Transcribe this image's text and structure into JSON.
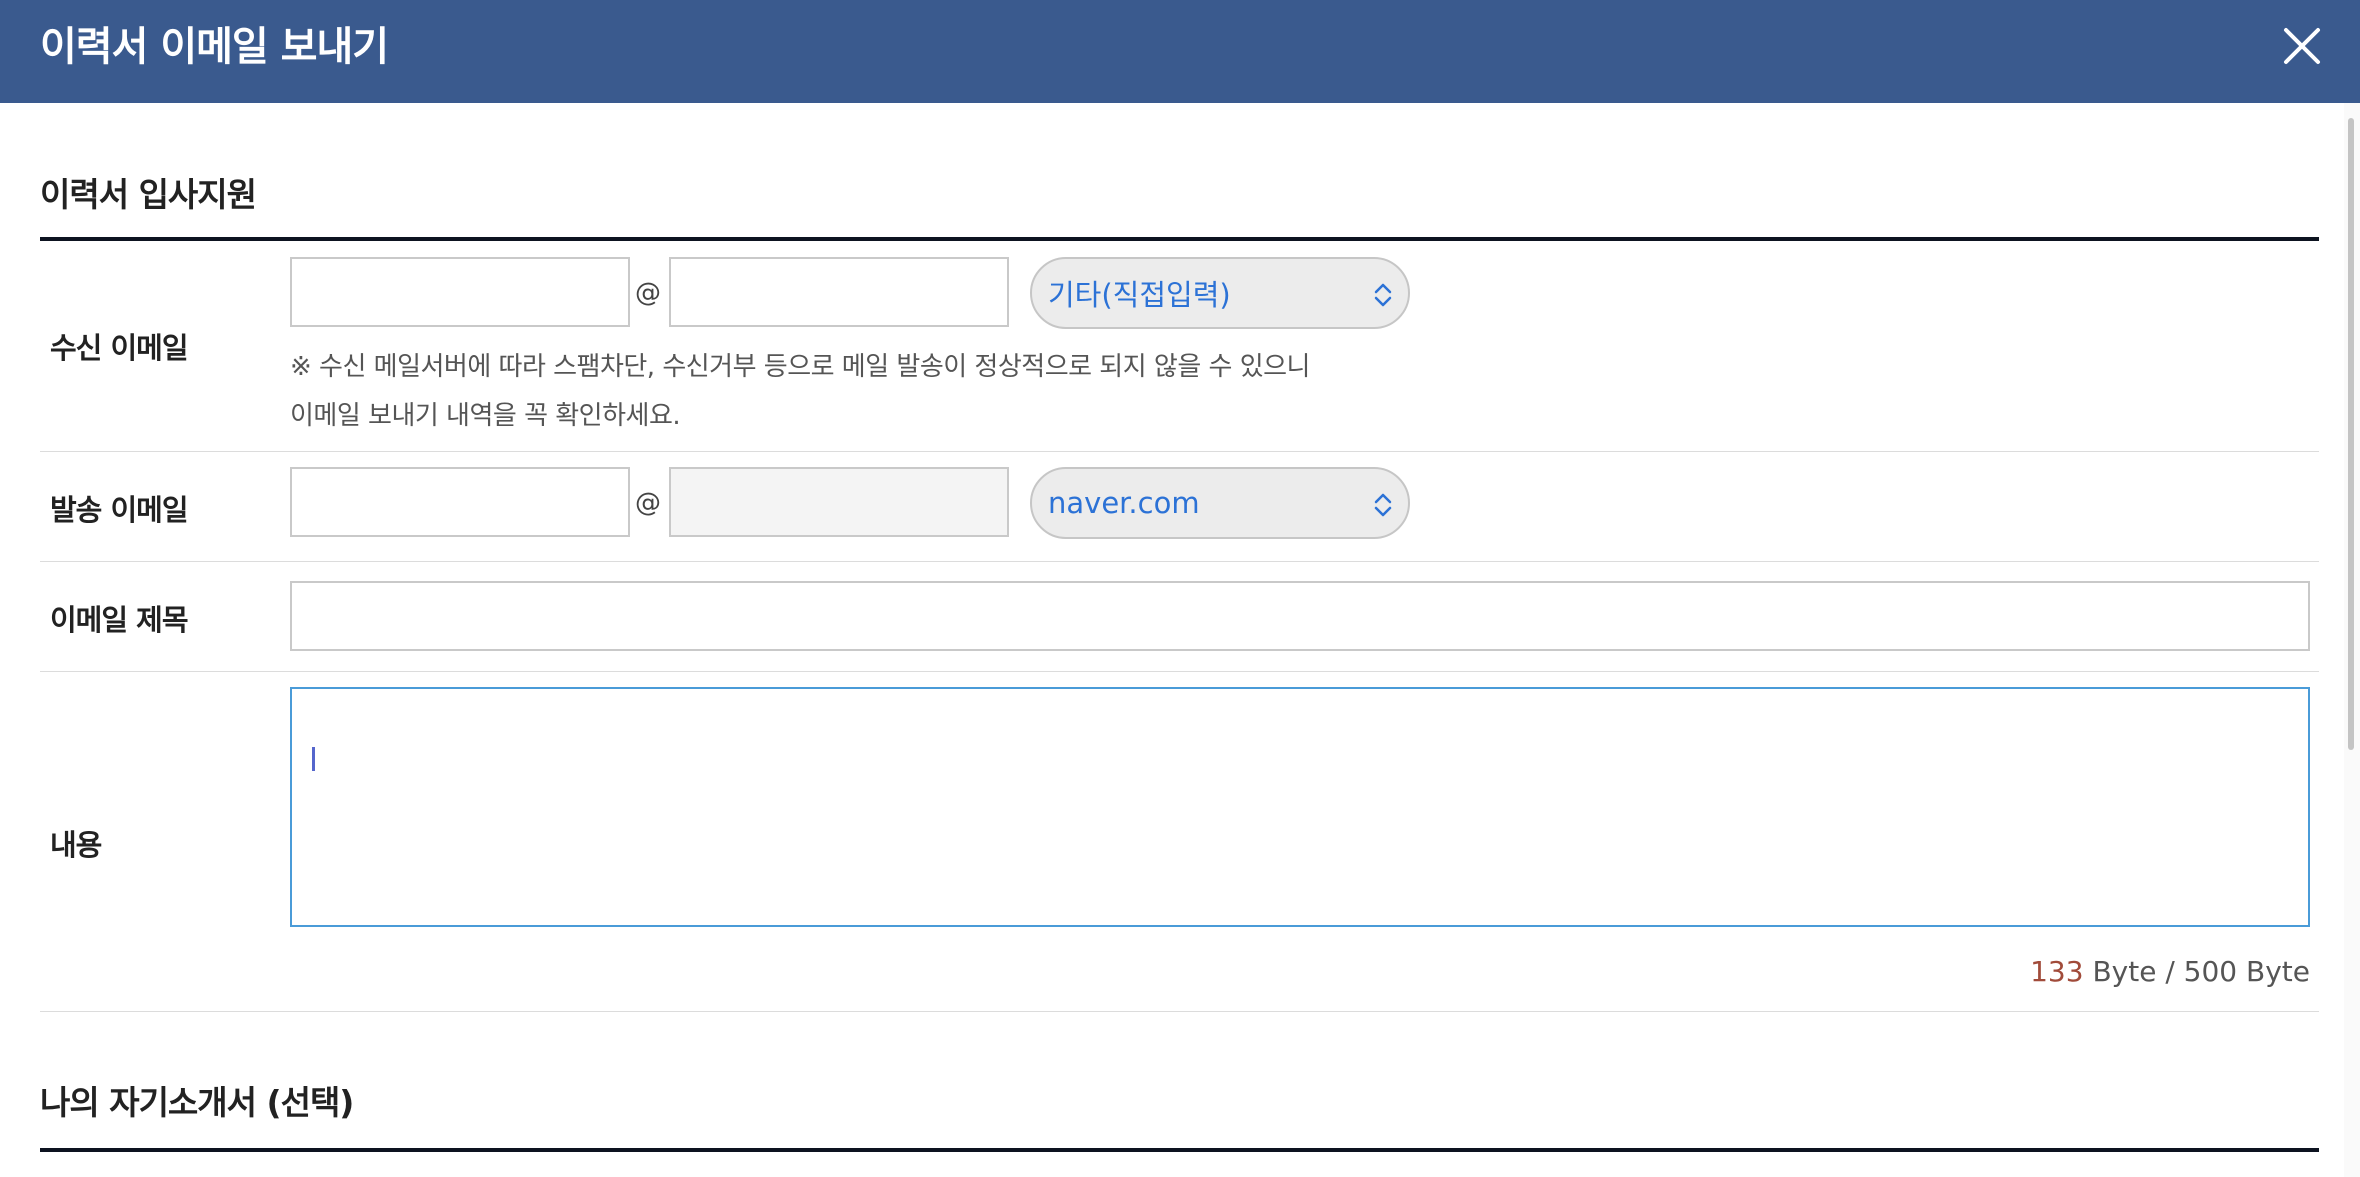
{
  "header": {
    "title": "이력서 이메일 보내기"
  },
  "section_apply": {
    "title": "이력서 입사지원"
  },
  "recipient": {
    "label": "수신 이메일",
    "local_value": "",
    "at": "@",
    "domain_value": "",
    "domain_select": "기타(직접입력)",
    "notice_line1": "※ 수신 메일서버에 따라 스팸차단, 수신거부 등으로 메일 발송이 정상적으로 되지 않을 수 있으니",
    "notice_line2": "이메일 보내기 내역을 꼭 확인하세요."
  },
  "sender": {
    "label": "발송 이메일",
    "local_value": "",
    "at": "@",
    "domain_value": "",
    "domain_select": "naver.com"
  },
  "subject": {
    "label": "이메일 제목",
    "value": ""
  },
  "content": {
    "label": "내용",
    "lines": [
      "",
      "",
      "",
      ""
    ]
  },
  "byte_counter": {
    "count": "133",
    "suffix": " Byte / 500 Byte"
  },
  "section_intro": {
    "title": "나의 자기소개서 (선택)"
  },
  "colors": {
    "header_bg": "#3a5a8e",
    "select_text": "#2c72d6",
    "textarea_focus": "#4a9bd8",
    "byte_count": "#a14b3a"
  },
  "icons": {
    "close": "close-icon",
    "select_arrow": "chevron-up-down-icon"
  }
}
